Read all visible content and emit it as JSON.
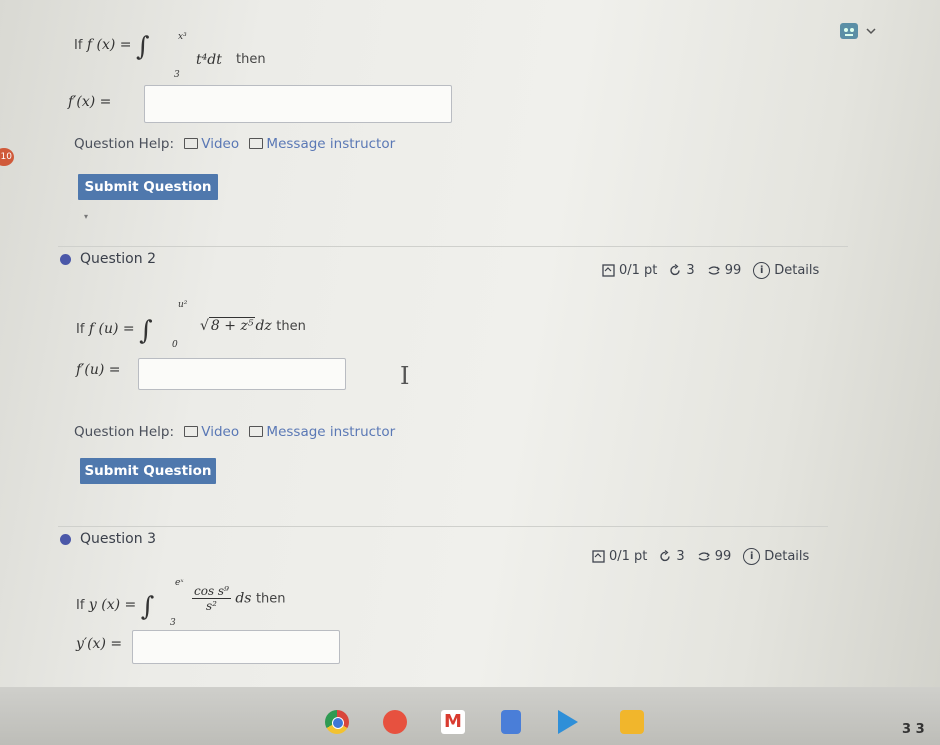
{
  "question1": {
    "if_word": "If",
    "func": "f (x) =",
    "upper_limit": "x³",
    "lower_limit": "3",
    "integrand": "t⁴dt",
    "then_word": "then",
    "answer_label": "f′(x) =",
    "answer_value": "",
    "help_label": "Question Help:",
    "video_label": "Video",
    "message_label": "Message instructor",
    "submit_label": "Submit Question"
  },
  "question2": {
    "title": "Question 2",
    "points": "0/1 pt",
    "tries": "3",
    "retries": "99",
    "details": "Details",
    "if_word": "If",
    "func": "f (u) =",
    "upper_limit": "u²",
    "lower_limit": "0",
    "integrand_root": "8 + z⁵",
    "integrand_tail": "dz",
    "then_word": "then",
    "answer_label": "f′(u) =",
    "answer_value": "",
    "help_label": "Question Help:",
    "video_label": "Video",
    "message_label": "Message instructor",
    "submit_label": "Submit Question"
  },
  "question3": {
    "title": "Question 3",
    "points": "0/1 pt",
    "tries": "3",
    "retries": "99",
    "details": "Details",
    "if_word": "If",
    "func": "y (x) =",
    "upper_limit": "eˣ",
    "lower_limit": "3",
    "numerator": "cos s⁹",
    "denominator": "s²",
    "integrand_tail": "ds",
    "then_word": "then",
    "answer_label": "y′(x) =",
    "answer_value": ""
  },
  "side_badge": "10",
  "taskbar": {
    "icons": [
      "chrome-icon",
      "tailwind-app-icon",
      "gmail-icon",
      "docs-icon",
      "play-store-icon",
      "keep-icon"
    ],
    "status_text": "3 3"
  },
  "colors": {
    "button": "#4f78ad",
    "link": "#5a78b5",
    "question_dot": "#4a57a8"
  }
}
